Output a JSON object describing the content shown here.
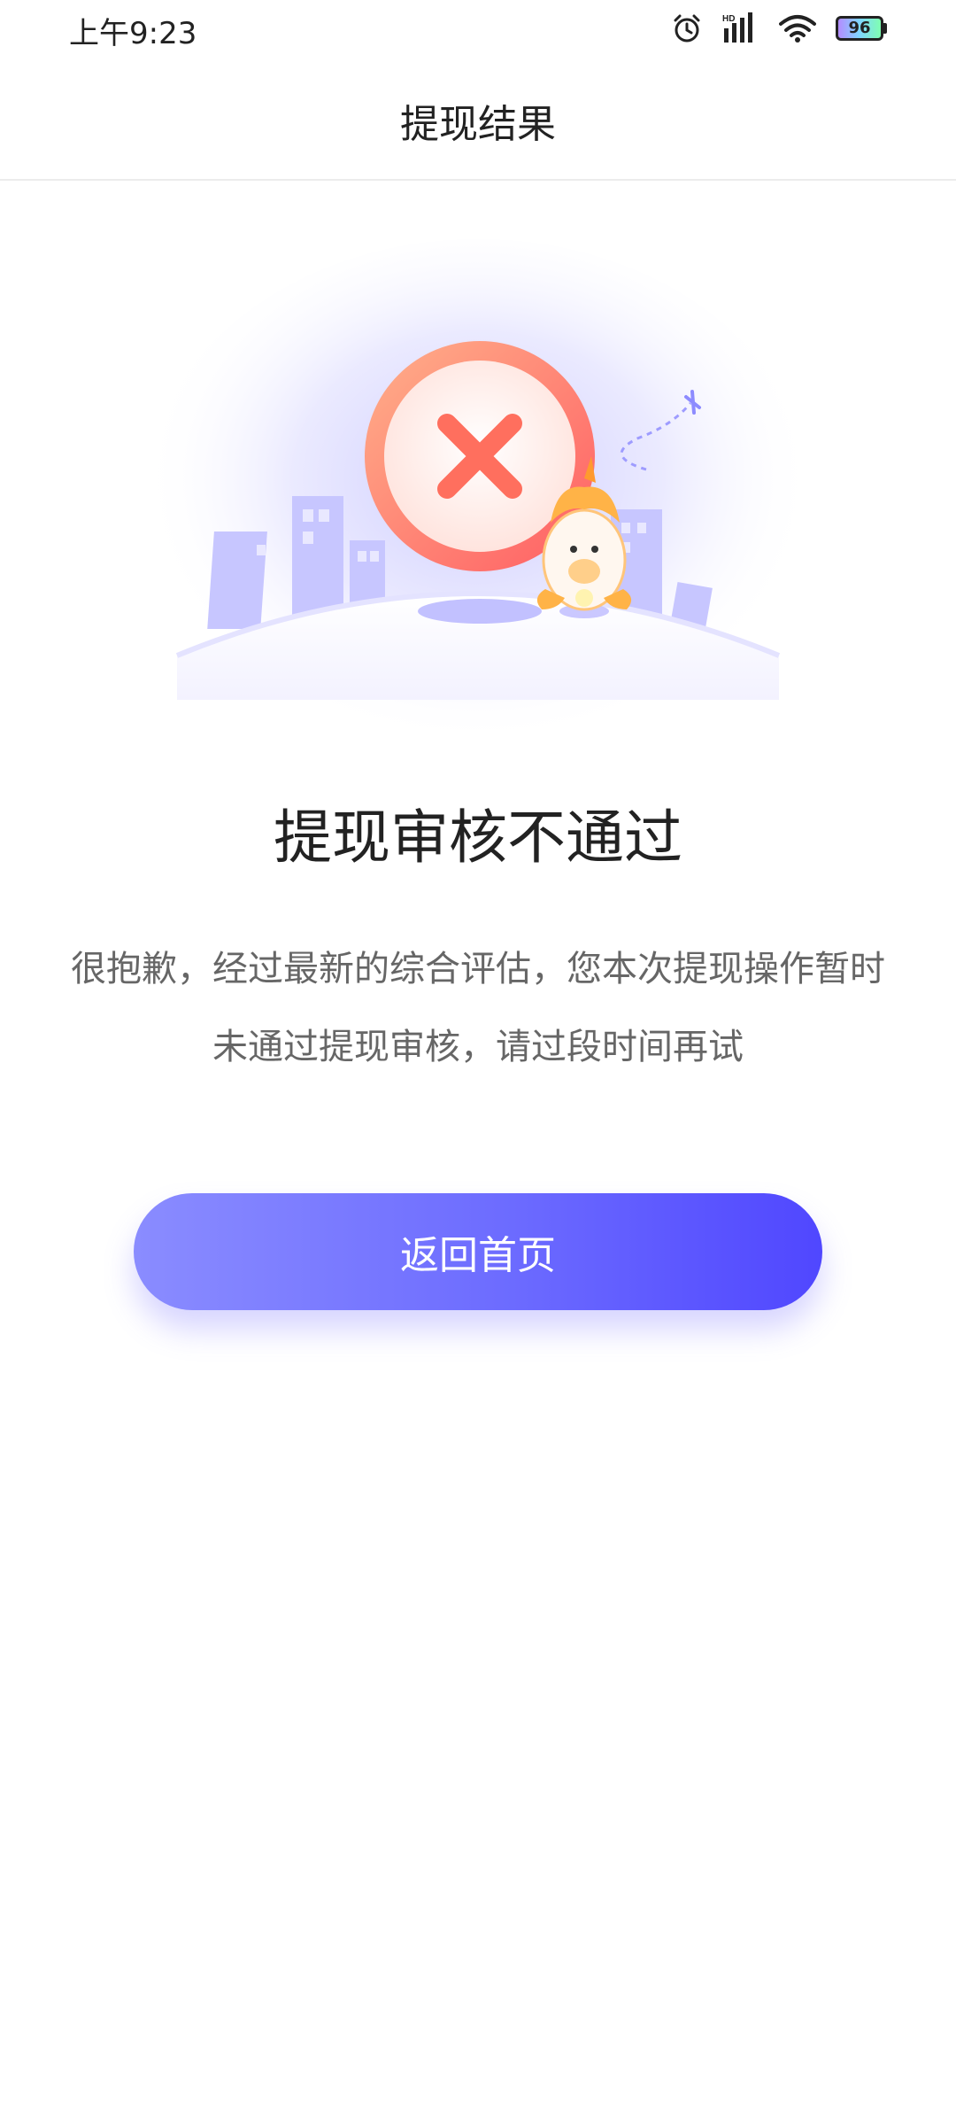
{
  "status_bar": {
    "time": "上午9:23",
    "signal_label": "HD",
    "battery_percent": "96",
    "icons": [
      "alarm-icon",
      "signal-icon",
      "wifi-icon",
      "battery-icon"
    ]
  },
  "header": {
    "title": "提现结果"
  },
  "result": {
    "illustration_icon": "error-x-icon",
    "title": "提现审核不通过",
    "description": "很抱歉，经过最新的综合评估，您本次提现操作暂时未通过提现审核，请过段时间再试"
  },
  "actions": {
    "home_label": "返回首页"
  },
  "colors": {
    "accent_start": "#8a8cff",
    "accent_end": "#5047ff",
    "error": "#ff6f5e"
  }
}
